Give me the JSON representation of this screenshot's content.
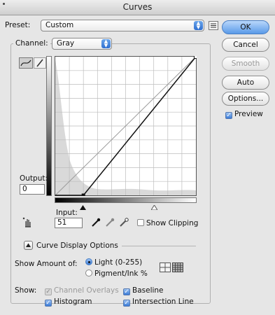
{
  "window": {
    "title": "Curves"
  },
  "preset": {
    "label": "Preset:",
    "value": "Custom"
  },
  "channel": {
    "label": "Channel:",
    "value": "Gray"
  },
  "buttons": {
    "ok": "OK",
    "cancel": "Cancel",
    "smooth": "Smooth",
    "auto": "Auto",
    "options": "Options..."
  },
  "preview": {
    "label": "Preview",
    "checked": true
  },
  "output": {
    "label": "Output:",
    "value": "0"
  },
  "input": {
    "label": "Input:",
    "value": "51"
  },
  "show_clipping": {
    "label": "Show Clipping",
    "checked": false
  },
  "curve_display": {
    "label": "Curve Display Options"
  },
  "show_amount": {
    "label": "Show Amount of:",
    "options": [
      "Light (0-255)",
      "Pigment/Ink %"
    ],
    "selected": "Light (0-255)"
  },
  "show": {
    "label": "Show:",
    "channel_overlays": {
      "label": "Channel Overlays",
      "checked": true,
      "enabled": false
    },
    "baseline": {
      "label": "Baseline",
      "checked": true
    },
    "histogram": {
      "label": "Histogram",
      "checked": true
    },
    "intersection_line": {
      "label": "Intersection Line",
      "checked": true
    }
  },
  "curve": {
    "points_input": [
      51,
      255
    ],
    "points_output": [
      0,
      255
    ],
    "grid_divisions": 10
  }
}
